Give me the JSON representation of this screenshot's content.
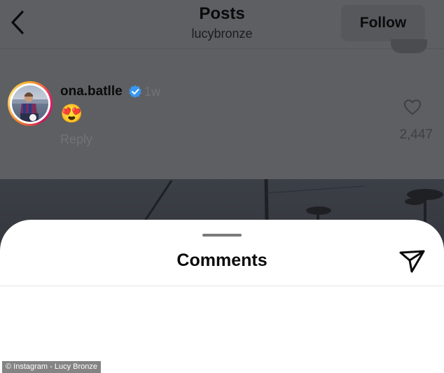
{
  "header": {
    "title": "Posts",
    "subtitle": "lucybronze",
    "follow_label": "Follow"
  },
  "sheet": {
    "title": "Comments"
  },
  "comment": {
    "username": "ona.batlle",
    "verified": true,
    "time": "1w",
    "text": "😍",
    "reply_label": "Reply",
    "likes": "2,447"
  },
  "watermark": "© Instagram - Lucy Bronze",
  "colors": {
    "overlay": "#5e5f62",
    "verified_blue": "#3897f0",
    "secondary_text": "#737373"
  },
  "icons": {
    "back": "chevron-left-icon",
    "share": "paper-plane-icon",
    "verified": "verified-badge-icon",
    "like": "heart-outline-icon"
  }
}
